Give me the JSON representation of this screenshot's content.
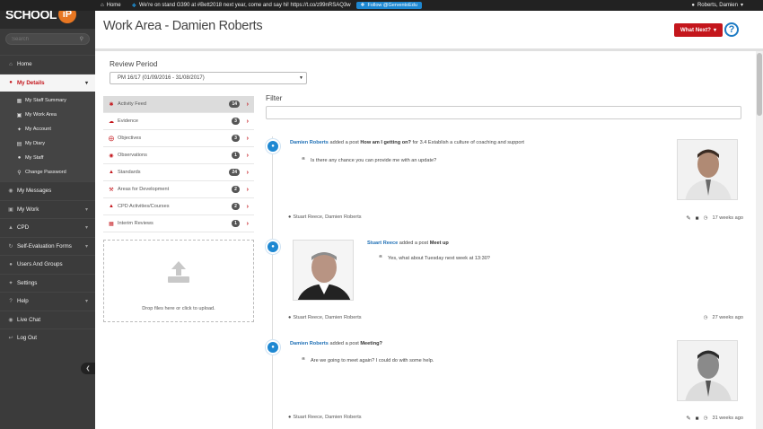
{
  "topbar": {
    "home_label": "Home",
    "tweet": "We're on stand G390 at #Bett2018 next year, come and say hi! https://t.co/z99nRSAQ3w",
    "follow_label": "Follow @GerventoEdu",
    "user_label": "Roberts, Damien"
  },
  "brand": {
    "logo_text": "SCHOOL",
    "logo_badge": "iP"
  },
  "search": {
    "placeholder": "Search"
  },
  "sidebar": {
    "items_top": [
      {
        "label": "Home",
        "icon": "home-icon"
      },
      {
        "label": "My Details",
        "icon": "user-icon"
      }
    ],
    "subitems": [
      {
        "label": "My Staff Summary",
        "icon": "id-card-icon"
      },
      {
        "label": "My Work Area",
        "icon": "briefcase-icon"
      },
      {
        "label": "My Account",
        "icon": "wrench-icon"
      },
      {
        "label": "My Diary",
        "icon": "calendar-icon"
      },
      {
        "label": "My Staff",
        "icon": "users-icon"
      },
      {
        "label": "Change Password",
        "icon": "key-icon"
      }
    ],
    "items_bottom": [
      {
        "label": "My Messages",
        "icon": "chat-icon"
      },
      {
        "label": "My Work",
        "icon": "briefcase-icon"
      },
      {
        "label": "CPD",
        "icon": "graduation-icon"
      },
      {
        "label": "Self-Evaluation Forms",
        "icon": "refresh-icon"
      },
      {
        "label": "Users And Groups",
        "icon": "users-icon"
      },
      {
        "label": "Settings",
        "icon": "wrench-icon"
      },
      {
        "label": "Help",
        "icon": "help-icon"
      },
      {
        "label": "Live Chat",
        "icon": "chat-icon"
      },
      {
        "label": "Log Out",
        "icon": "logout-icon"
      }
    ]
  },
  "header": {
    "title": "Work Area - Damien Roberts",
    "what_next_label": "What Next?",
    "help_label": "?"
  },
  "review_period": {
    "label": "Review Period",
    "selected": "PM 16/17 (01/09/2016 - 31/08/2017)"
  },
  "categories": [
    {
      "label": "Activity Feed",
      "count": "14",
      "icon": "asterisk-icon"
    },
    {
      "label": "Evidence",
      "count": "3",
      "icon": "cloud-icon"
    },
    {
      "label": "Objectives",
      "count": "3",
      "icon": "crosshairs-icon"
    },
    {
      "label": "Observations",
      "count": "1",
      "icon": "eye-icon"
    },
    {
      "label": "Standards",
      "count": "24",
      "icon": "thumbs-up-icon"
    },
    {
      "label": "Areas for Development",
      "count": "2",
      "icon": "gavel-icon"
    },
    {
      "label": "CPD Activities/Courses",
      "count": "2",
      "icon": "graduation-icon"
    },
    {
      "label": "Interim Reviews",
      "count": "1",
      "icon": "bar-chart-icon"
    }
  ],
  "dropzone": {
    "text": "Drop files here or click to upload."
  },
  "filter": {
    "label": "Filter",
    "value": ""
  },
  "posts": [
    {
      "author": "Damien Roberts",
      "action": "added a post",
      "title": "How am I getting on?",
      "suffix": "for 3.4 Establish a culture of coaching and support",
      "quote": "Is there any chance you can provide me with an update?",
      "participants": "Stuart Reece, Damien Roberts",
      "time": "17 weeks ago"
    },
    {
      "author": "Stuart Reece",
      "action": "added a post",
      "title": "Meet up",
      "suffix": "",
      "quote": "Yes, what about Tuesday next week at 13:30?",
      "participants": "Stuart Reece, Damien Roberts",
      "time": "27 weeks ago"
    },
    {
      "author": "Damien Roberts",
      "action": "added a post",
      "title": "Meeting?",
      "suffix": "",
      "quote": "Are we going to meet again? I could do with some help.",
      "participants": "Stuart Reece, Damien Roberts",
      "time": "31 weeks ago"
    }
  ],
  "colors": {
    "accent_red": "#c4161c",
    "link_blue": "#1e6fb5",
    "sidebar_bg": "#3b3b3b",
    "brand_orange": "#e87722"
  }
}
